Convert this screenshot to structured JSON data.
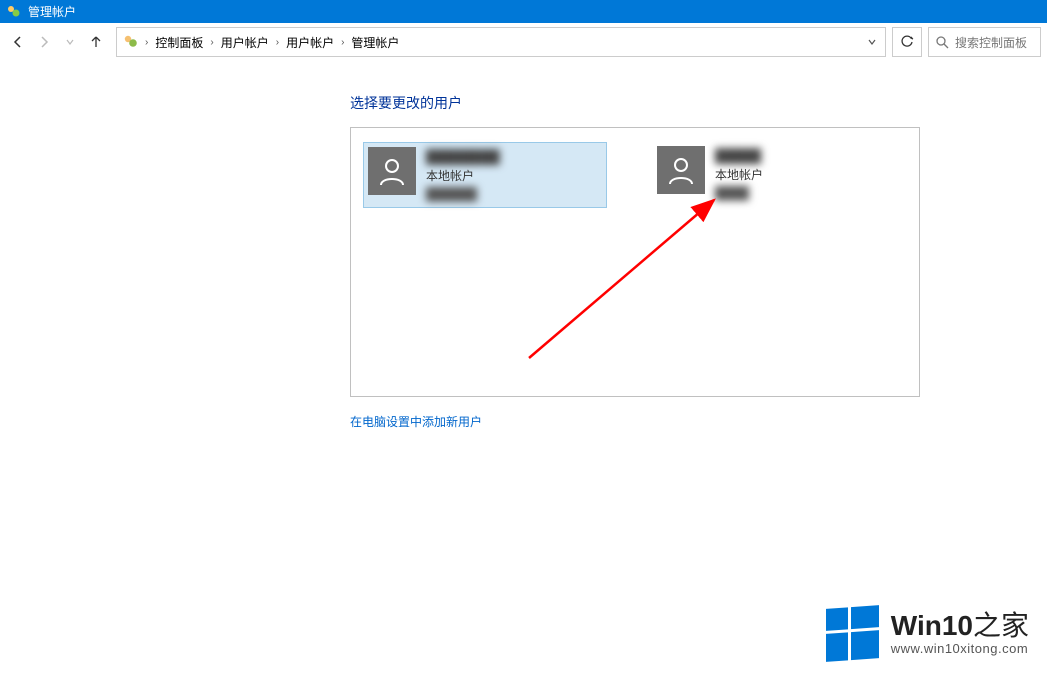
{
  "window": {
    "title": "管理帐户"
  },
  "breadcrumbs": {
    "root": "控制面板",
    "level1": "用户帐户",
    "level2": "用户帐户",
    "level3": "管理帐户"
  },
  "search": {
    "placeholder": "搜索控制面板"
  },
  "page": {
    "heading": "选择要更改的用户",
    "add_user_link": "在电脑设置中添加新用户"
  },
  "users": [
    {
      "name": "████████",
      "type": "本地帐户",
      "extra": "██████",
      "selected": true
    },
    {
      "name": "█████",
      "type": "本地帐户",
      "extra": "████",
      "selected": false
    }
  ],
  "watermark": {
    "brand_en": "Win10",
    "brand_zh": "之家",
    "url": "www.win10xitong.com"
  }
}
